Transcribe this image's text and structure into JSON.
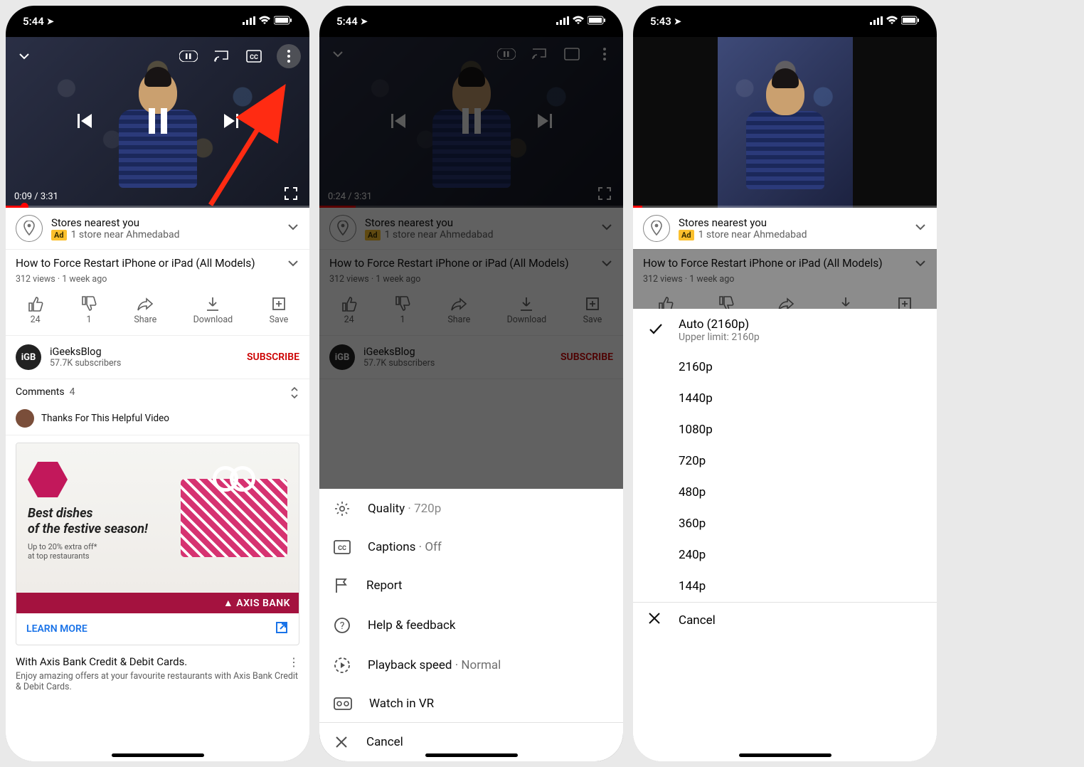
{
  "status": {
    "time1": "5:44",
    "time2": "5:44",
    "time3": "5:43"
  },
  "player": {
    "elapsed1": "0:09",
    "elapsed2": "0:24",
    "total": "3:31"
  },
  "ad": {
    "title": "Stores nearest you",
    "badge": "Ad",
    "line2": "1 store near Ahmedabad"
  },
  "video": {
    "title": "How to Force Restart iPhone or iPad (All Models)",
    "views": "312 views",
    "age": "1 week ago"
  },
  "actions": {
    "like": "24",
    "dislike": "1",
    "share": "Share",
    "download": "Download",
    "save": "Save"
  },
  "channel": {
    "name": "iGeeksBlog",
    "subs": "57.7K subscribers",
    "avatar": "iGB",
    "subscribe": "SUBSCRIBE"
  },
  "comments": {
    "label": "Comments",
    "count": "4",
    "top": "Thanks For This Helpful Video"
  },
  "promo": {
    "headline1": "Best dishes",
    "headline2": "of the festive season!",
    "discount": "Up to 20% extra off*",
    "discount_sub": "at top restaurants",
    "bank": "AXIS BANK",
    "learn": "LEARN MORE",
    "desc_title": "With Axis Bank Credit & Debit Cards.",
    "desc_body": "Enjoy amazing offers at your favourite restaurants with Axis Bank Credit & Debit Cards."
  },
  "menu": {
    "quality": "Quality",
    "quality_val": "720p",
    "captions": "Captions",
    "captions_val": "Off",
    "report": "Report",
    "help": "Help & feedback",
    "speed": "Playback speed",
    "speed_val": "Normal",
    "vr": "Watch in VR",
    "cancel": "Cancel"
  },
  "quality": {
    "auto": "Auto (2160p)",
    "auto_sub": "Upper limit: 2160p",
    "opts": [
      "2160p",
      "1440p",
      "1080p",
      "720p",
      "480p",
      "360p",
      "240p",
      "144p"
    ],
    "cancel": "Cancel"
  }
}
